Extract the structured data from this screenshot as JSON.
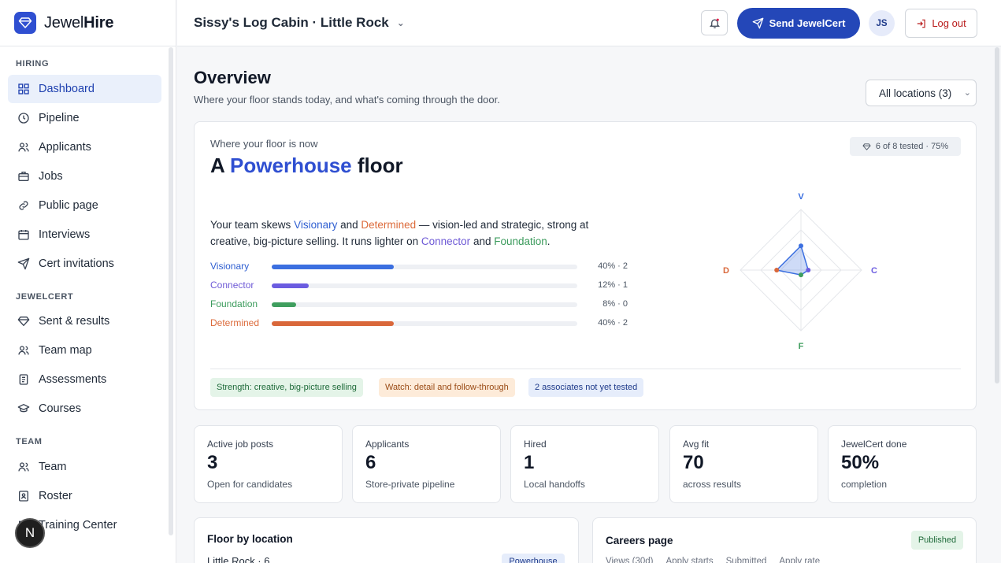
{
  "brand": {
    "name_prefix": "Jewel",
    "name_bold": "Hire"
  },
  "sidebar": {
    "sections": [
      {
        "label": "HIRING"
      },
      {
        "label": "JEWELCERT"
      },
      {
        "label": "TEAM"
      }
    ],
    "items": [
      {
        "label": "Dashboard",
        "icon": "grid-icon",
        "active": true
      },
      {
        "label": "Pipeline",
        "icon": "clock-icon"
      },
      {
        "label": "Applicants",
        "icon": "users-icon"
      },
      {
        "label": "Jobs",
        "icon": "briefcase-icon"
      },
      {
        "label": "Public page",
        "icon": "link-icon"
      },
      {
        "label": "Interviews",
        "icon": "calendar-icon"
      },
      {
        "label": "Cert invitations",
        "icon": "send-icon"
      },
      {
        "label": "Sent & results",
        "icon": "gem-icon"
      },
      {
        "label": "Team map",
        "icon": "users-icon"
      },
      {
        "label": "Assessments",
        "icon": "clipboard-icon"
      },
      {
        "label": "Courses",
        "icon": "graduation-cap-icon"
      },
      {
        "label": "Team",
        "icon": "users-icon"
      },
      {
        "label": "Roster",
        "icon": "id-card-icon"
      },
      {
        "label": "Training Center",
        "icon": "book-icon"
      }
    ],
    "avatar_letter": "N"
  },
  "topbar": {
    "store": "Sissy's Log Cabin · Little Rock",
    "send_label": "Send JewelCert",
    "avatar_initials": "JS",
    "logout_label": "Log out"
  },
  "overview": {
    "title": "Overview",
    "subtitle": "Where your floor stands today, and what's coming through the door.",
    "location_select": "All locations (3)"
  },
  "floor": {
    "eyebrow": "Where your floor is now",
    "title_prefix": "A ",
    "title_accent": "Powerhouse",
    "title_suffix": " floor",
    "tested_badge": "6 of 8 tested · 75%",
    "desc": {
      "p1": "Your team skews ",
      "visionary": "Visionary",
      "p2": " and ",
      "determined": "Determined",
      "p3": " — vision-led and strategic, strong at creative, big-picture selling. It runs lighter on ",
      "connector": "Connector",
      "p4": " and ",
      "foundation": "Foundation",
      "p5": "."
    },
    "bars": [
      {
        "label": "Visionary",
        "value_text": "40% · 2",
        "pct": 0.4,
        "color": "#3b6fe0"
      },
      {
        "label": "Connector",
        "value_text": "12% · 1",
        "pct": 0.12,
        "color": "#6b5ce0"
      },
      {
        "label": "Foundation",
        "value_text": "8% · 0",
        "pct": 0.08,
        "color": "#3f9e5e"
      },
      {
        "label": "Determined",
        "value_text": "40% · 2",
        "pct": 0.4,
        "color": "#d9673a"
      }
    ],
    "radar": {
      "axes": {
        "v": "V",
        "c": "C",
        "f": "F",
        "d": "D"
      },
      "values": {
        "v": 0.4,
        "c": 0.12,
        "f": 0.08,
        "d": 0.4
      }
    },
    "chips": {
      "strength": "Strength: creative, big-picture selling",
      "watch": "Watch: detail and follow-through",
      "untested": "2 associates not yet tested"
    }
  },
  "stats": [
    {
      "label": "Active job posts",
      "value": "3",
      "sub": "Open for candidates"
    },
    {
      "label": "Applicants",
      "value": "6",
      "sub": "Store-private pipeline"
    },
    {
      "label": "Hired",
      "value": "1",
      "sub": "Local handoffs"
    },
    {
      "label": "Avg fit",
      "value": "70",
      "sub": "across results"
    },
    {
      "label": "JewelCert done",
      "value": "50%",
      "sub": "completion"
    }
  ],
  "floor_by_location": {
    "title": "Floor by location",
    "first_row": "Little Rock · 6",
    "first_badge": "Powerhouse"
  },
  "careers": {
    "title": "Careers page",
    "status": "Published",
    "columns": [
      "Views (30d)",
      "Apply starts",
      "Submitted",
      "Apply rate"
    ]
  }
}
